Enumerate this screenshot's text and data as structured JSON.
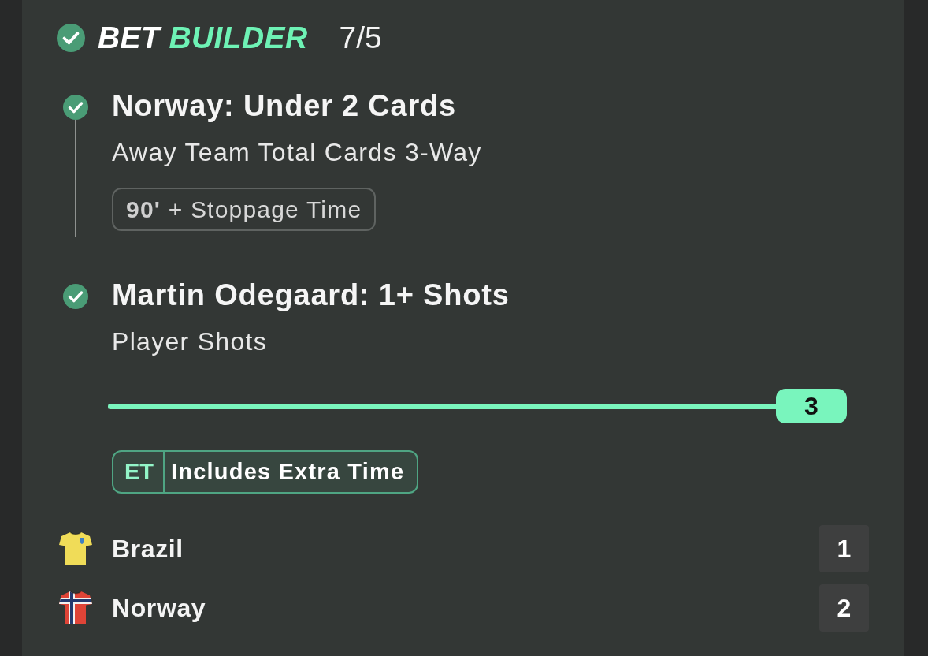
{
  "header": {
    "checked": true,
    "title_words": [
      {
        "text": "BET",
        "highlighted": false
      },
      {
        "text": "BUILDER",
        "highlighted": true
      }
    ],
    "odds": "7/5"
  },
  "legs": [
    {
      "checked": true,
      "selection": "Norway: Under 2 Cards",
      "market": "Away Team Total Cards 3-Way",
      "extras": [
        {
          "kind": "period",
          "text": "**90'** + Stoppage Time"
        }
      ]
    },
    {
      "checked": true,
      "selection": "Martin Odegaard: 1+ Shots",
      "market": "Player Shots",
      "extras": [
        {
          "kind": "slider",
          "level": 1,
          "value": "3"
        },
        {
          "kind": "extra-time",
          "code": "ET",
          "text": "Includes Extra Time"
        }
      ]
    }
  ],
  "teams": [
    {
      "name": "Brazil",
      "score": "1",
      "kind": "crest",
      "color": "#f0dc58"
    },
    {
      "name": "Norway",
      "score": "2",
      "kind": "cross",
      "color": "#df4437"
    }
  ]
}
